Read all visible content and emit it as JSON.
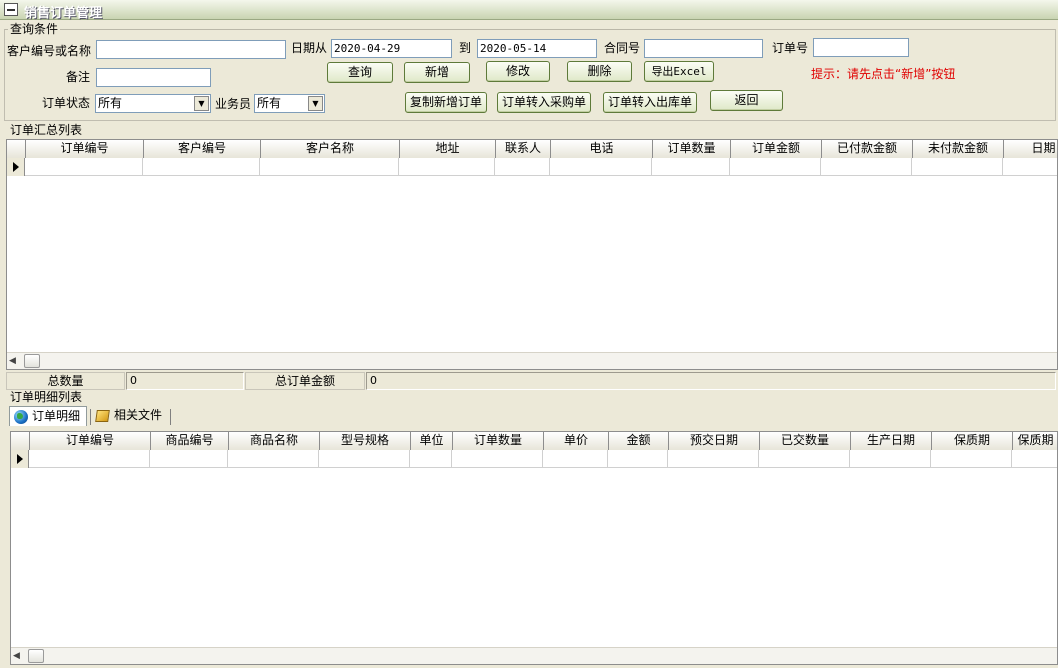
{
  "window": {
    "title": "销售订单管理"
  },
  "query": {
    "group_title": "查询条件",
    "customer_label": "客户编号或名称",
    "customer_value": "",
    "date_from_label": "日期从",
    "date_from": "2020-04-29",
    "date_to_label": "到",
    "date_to": "2020-05-14",
    "contract_label": "合同号",
    "contract_value": "",
    "order_no_label": "订单号",
    "order_no_value": "",
    "remark_label": "备注",
    "remark_value": "",
    "status_label": "订单状态",
    "status_value": "所有",
    "salesman_label": "业务员",
    "salesman_value": "所有",
    "hint": "提示：请先点击“新增”按钮"
  },
  "buttons": {
    "query": "查询",
    "add": "新增",
    "edit": "修改",
    "delete": "删除",
    "export": "导出Excel",
    "copy_new": "复制新增订单",
    "to_purchase": "订单转入采购单",
    "to_outbound": "订单转入出库单",
    "back": "返回"
  },
  "summary_grid": {
    "title": "订单汇总列表",
    "columns": [
      "订单编号",
      "客户编号",
      "客户名称",
      "地址",
      "联系人",
      "电话",
      "订单数量",
      "订单金额",
      "已付款金额",
      "未付款金额",
      "日期"
    ]
  },
  "totals": {
    "qty_label": "总数量",
    "qty_value": "0",
    "amount_label": "总订单金额",
    "amount_value": "0"
  },
  "detail": {
    "title": "订单明细列表",
    "tabs": [
      "订单明细",
      "相关文件"
    ],
    "columns": [
      "订单编号",
      "商品编号",
      "商品名称",
      "型号规格",
      "单位",
      "订单数量",
      "单价",
      "金额",
      "预交日期",
      "已交数量",
      "生产日期",
      "保质期",
      "保质期"
    ]
  }
}
